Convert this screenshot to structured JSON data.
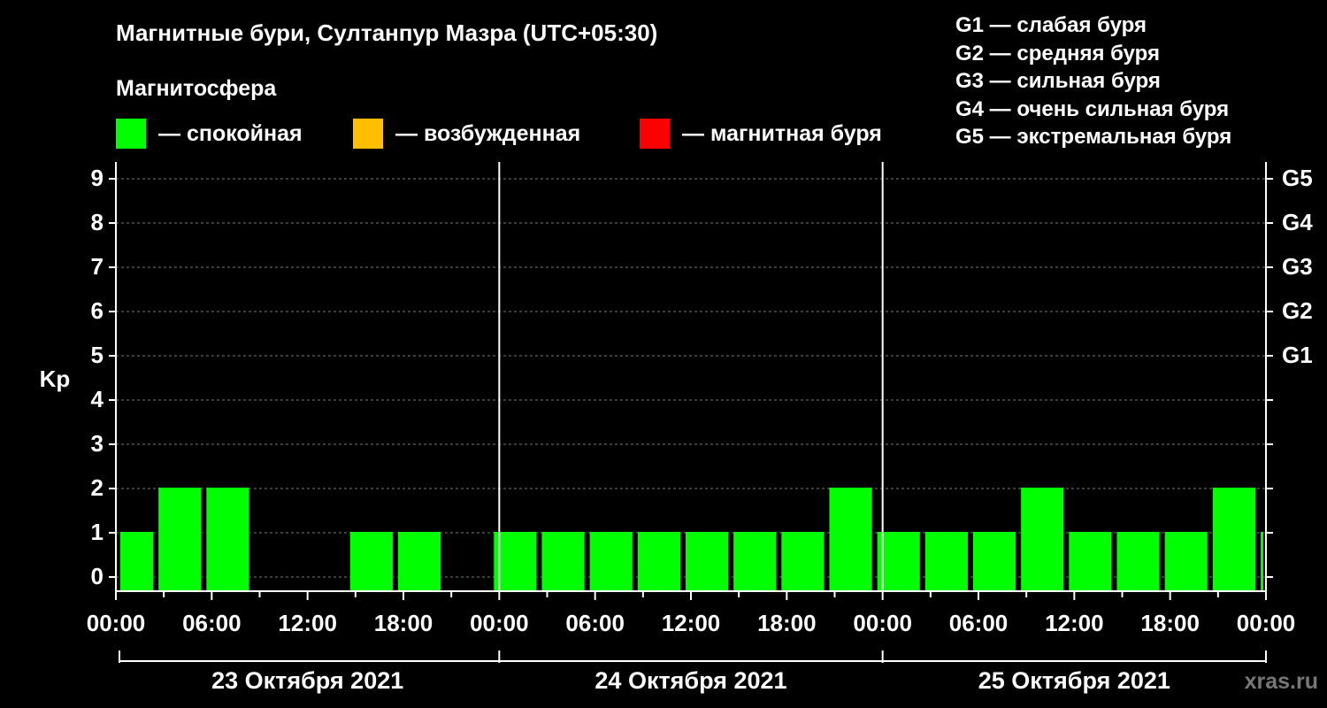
{
  "title": "Магнитные бури, Султанпур Мазра (UTC+05:30)",
  "legend": {
    "title": "Магнитосфера",
    "items": [
      {
        "label": "— спокойная",
        "color": "#00ff00"
      },
      {
        "label": "— возбужденная",
        "color": "#ffbf00"
      },
      {
        "label": "— магнитная буря",
        "color": "#ff0000"
      }
    ]
  },
  "g_scale": [
    "G1 — слабая буря",
    "G2 — средняя буря",
    "G3 — сильная буря",
    "G4 — очень сильная буря",
    "G5 — экстремальная буря"
  ],
  "watermark": "xras.ru",
  "chart_data": {
    "type": "bar",
    "ylabel": "Kp",
    "ylim": [
      0,
      9
    ],
    "yticks": [
      "0",
      "1",
      "2",
      "3",
      "4",
      "5",
      "6",
      "7",
      "8",
      "9"
    ],
    "right_ticks": [
      {
        "y": 5,
        "label": "G1"
      },
      {
        "y": 6,
        "label": "G2"
      },
      {
        "y": 7,
        "label": "G3"
      },
      {
        "y": 8,
        "label": "G4"
      },
      {
        "y": 9,
        "label": "G5"
      }
    ],
    "x_tick_labels": [
      "00:00",
      "06:00",
      "12:00",
      "18:00",
      "00:00",
      "06:00",
      "12:00",
      "18:00",
      "00:00",
      "06:00",
      "12:00",
      "18:00",
      "00:00"
    ],
    "days": [
      "23 Октября 2021",
      "24 Октября 2021",
      "25 Октября 2021"
    ],
    "grid": "dashed horizontal",
    "bars": [
      {
        "start_hour": 0,
        "end_hour": 2.5,
        "kp": 1
      },
      {
        "start_hour": 2.5,
        "end_hour": 5.5,
        "kp": 2
      },
      {
        "start_hour": 5.5,
        "end_hour": 8.5,
        "kp": 2
      },
      {
        "start_hour": 8.5,
        "end_hour": 11.5,
        "kp": 0
      },
      {
        "start_hour": 11.5,
        "end_hour": 14.5,
        "kp": 0
      },
      {
        "start_hour": 14.5,
        "end_hour": 17.5,
        "kp": 1
      },
      {
        "start_hour": 17.5,
        "end_hour": 20.5,
        "kp": 1
      },
      {
        "start_hour": 20.5,
        "end_hour": 23.5,
        "kp": 0
      },
      {
        "start_hour": 23.5,
        "end_hour": 26.5,
        "kp": 1
      },
      {
        "start_hour": 26.5,
        "end_hour": 29.5,
        "kp": 1
      },
      {
        "start_hour": 29.5,
        "end_hour": 32.5,
        "kp": 1
      },
      {
        "start_hour": 32.5,
        "end_hour": 35.5,
        "kp": 1
      },
      {
        "start_hour": 35.5,
        "end_hour": 38.5,
        "kp": 1
      },
      {
        "start_hour": 38.5,
        "end_hour": 41.5,
        "kp": 1
      },
      {
        "start_hour": 41.5,
        "end_hour": 44.5,
        "kp": 1
      },
      {
        "start_hour": 44.5,
        "end_hour": 47.5,
        "kp": 2
      },
      {
        "start_hour": 47.5,
        "end_hour": 50.5,
        "kp": 1
      },
      {
        "start_hour": 50.5,
        "end_hour": 53.5,
        "kp": 1
      },
      {
        "start_hour": 53.5,
        "end_hour": 56.5,
        "kp": 1
      },
      {
        "start_hour": 56.5,
        "end_hour": 59.5,
        "kp": 2
      },
      {
        "start_hour": 59.5,
        "end_hour": 62.5,
        "kp": 1
      },
      {
        "start_hour": 62.5,
        "end_hour": 65.5,
        "kp": 1
      },
      {
        "start_hour": 65.5,
        "end_hour": 68.5,
        "kp": 1
      },
      {
        "start_hour": 68.5,
        "end_hour": 71.5,
        "kp": 2
      },
      {
        "start_hour": 71.5,
        "end_hour": 72,
        "kp": 1
      }
    ]
  }
}
